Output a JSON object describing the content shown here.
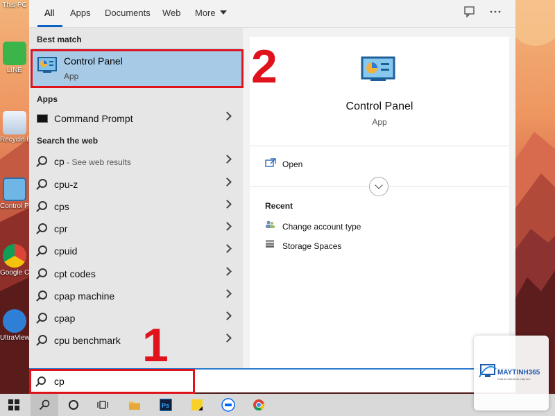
{
  "desktop": {
    "icons": [
      {
        "label": "This PC"
      },
      {
        "label": "LINE"
      },
      {
        "label": "Recycle Bin"
      },
      {
        "label": "Control Panel"
      },
      {
        "label": "Google Chrome"
      },
      {
        "label": "UltraViewer"
      }
    ]
  },
  "tabs": {
    "all": "All",
    "apps": "Apps",
    "documents": "Documents",
    "web": "Web",
    "more": "More"
  },
  "left": {
    "best_match_heading": "Best match",
    "best_match": {
      "title": "Control Panel",
      "subtitle": "App"
    },
    "apps_heading": "Apps",
    "apps": [
      {
        "label": "Command Prompt"
      }
    ],
    "web_heading": "Search the web",
    "web_first": {
      "query": "cp",
      "suffix": " - See web results"
    },
    "web_results": [
      "cpu-z",
      "cps",
      "cpr",
      "cpuid",
      "cpt codes",
      "cpap machine",
      "cpap",
      "cpu benchmark"
    ]
  },
  "right": {
    "title": "Control Panel",
    "subtitle": "App",
    "open_label": "Open",
    "recent_heading": "Recent",
    "recent": [
      "Change account type",
      "Storage Spaces"
    ]
  },
  "search": {
    "value": "cp"
  },
  "annotations": {
    "step1": "1",
    "step2": "2"
  },
  "watermark": {
    "brand": "MAYTINH365",
    "tagline": "Chia sẻ kiến thức máy tính"
  },
  "colors": {
    "highlight": "#a7cbe7",
    "annotation": "#e0131c",
    "accent": "#0a64c8"
  }
}
